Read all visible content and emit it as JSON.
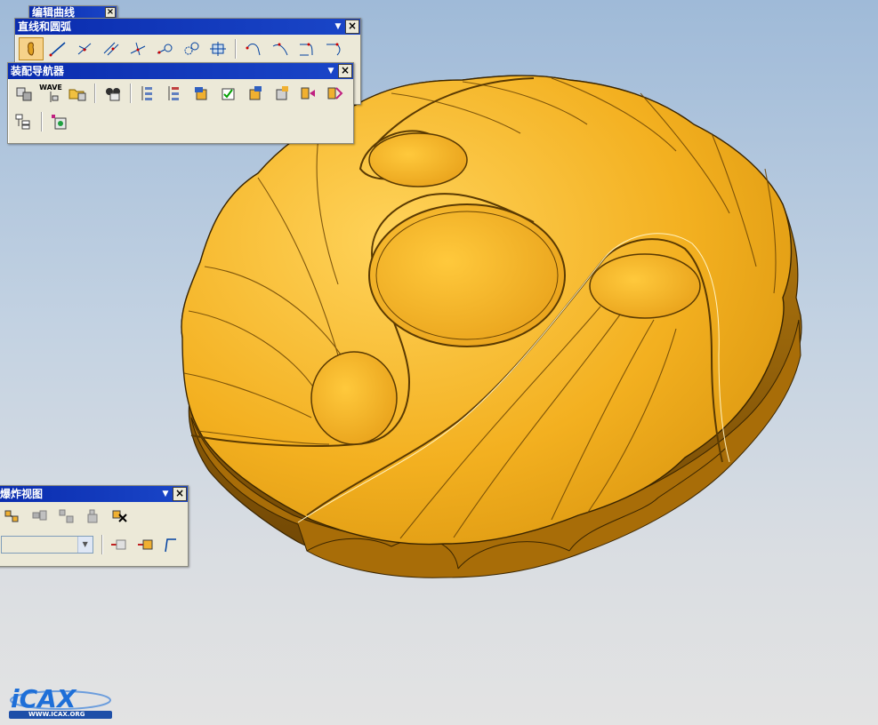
{
  "toolbars": {
    "edit_curve": {
      "title": "编辑曲线"
    },
    "line_arc": {
      "title": "直线和圆弧"
    },
    "assembly_navigator": {
      "title": "装配导航器",
      "wave_label": "WAVE"
    },
    "exploded_view": {
      "title": "爆炸视图",
      "combo_value": ""
    }
  },
  "logo": {
    "brand_text": "www.icax.org"
  },
  "colors": {
    "titlebar": "#0a2cae",
    "toolbar_bg": "#ece9d8",
    "part_gold": "#f2b01e",
    "part_dark": "#8a5a05",
    "logo_blue": "#1e6fd8"
  }
}
